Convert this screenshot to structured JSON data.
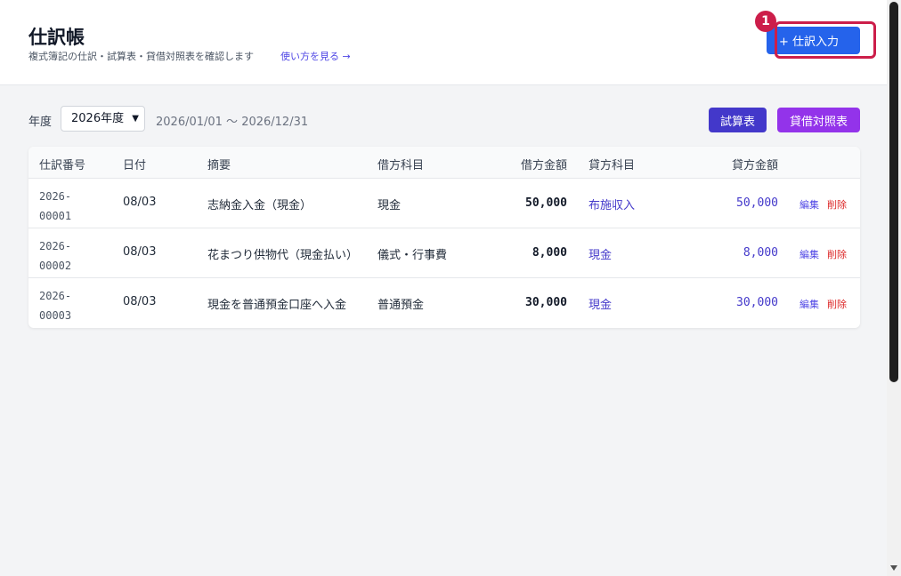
{
  "header": {
    "title": "仕訳帳",
    "subtitle": "複式簿記の仕訳・試算表・貸借対照表を確認します",
    "help_link": "使い方を見る →",
    "new_entry_label": "+ 仕訳入力",
    "step_badge": "1"
  },
  "toolbar": {
    "year_label": "年度",
    "year_selected": "2026年度",
    "date_range": "2026/01/01 〜 2026/12/31",
    "trial_balance_label": "試算表",
    "balance_sheet_label": "貸借対照表"
  },
  "table": {
    "columns": [
      "仕訳番号",
      "日付",
      "摘要",
      "借方科目",
      "借方金額",
      "貸方科目",
      "貸方金額"
    ],
    "rows": [
      {
        "no_line1": "2026-",
        "no_line2": "00001",
        "date": "08/03",
        "summary": "志納金入金（現金）",
        "debit_account": "現金",
        "debit_amount": "50,000",
        "credit_account": "布施収入",
        "credit_amount": "50,000",
        "edit": "編集",
        "delete": "削除"
      },
      {
        "no_line1": "2026-",
        "no_line2": "00002",
        "date": "08/03",
        "summary": "花まつり供物代（現金払い）",
        "debit_account": "儀式・行事費",
        "debit_amount": "8,000",
        "credit_account": "現金",
        "credit_amount": "8,000",
        "edit": "編集",
        "delete": "削除"
      },
      {
        "no_line1": "2026-",
        "no_line2": "00003",
        "date": "08/03",
        "summary": "現金を普通預金口座へ入金",
        "debit_account": "普通預金",
        "debit_amount": "30,000",
        "credit_account": "現金",
        "credit_amount": "30,000",
        "edit": "編集",
        "delete": "削除"
      }
    ]
  },
  "colors": {
    "primary": "#2563eb",
    "indigo": "#4338ca",
    "purple": "#9333ea",
    "highlight": "#cc1e4a",
    "delete": "#dc2626"
  }
}
